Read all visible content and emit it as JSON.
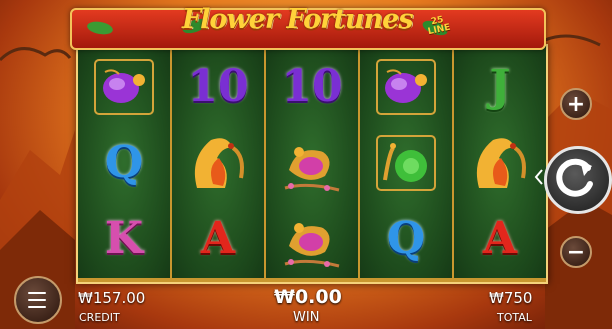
{
  "game": {
    "title": "Flower Fortunes",
    "lines_number": "25",
    "lines_label": "LINE"
  },
  "reels": [
    [
      {
        "kind": "bug-purple"
      },
      {
        "kind": "letter",
        "text": "Q",
        "color": "blue"
      },
      {
        "kind": "letter",
        "text": "K",
        "color": "pink"
      }
    ],
    [
      {
        "kind": "letter",
        "text": "10",
        "color": "purple"
      },
      {
        "kind": "phoenix"
      },
      {
        "kind": "letter",
        "text": "A",
        "color": "red"
      }
    ],
    [
      {
        "kind": "letter",
        "text": "10",
        "color": "purple"
      },
      {
        "kind": "bird-pink"
      },
      {
        "kind": "bird-pink"
      }
    ],
    [
      {
        "kind": "bug-purple"
      },
      {
        "kind": "snail-green"
      },
      {
        "kind": "letter",
        "text": "Q",
        "color": "blue"
      }
    ],
    [
      {
        "kind": "letter",
        "text": "J",
        "color": "green"
      },
      {
        "kind": "phoenix"
      },
      {
        "kind": "letter",
        "text": "A",
        "color": "red"
      }
    ]
  ],
  "controls": {
    "plus_symbol": "+",
    "minus_symbol": "−",
    "spin_icon": "spin-refresh-icon",
    "menu_icon": "hamburger-menu-icon"
  },
  "stats": {
    "credit_value": "₩157.00",
    "credit_label": "CREDIT",
    "win_value": "₩0.00",
    "win_label": "WIN",
    "total_value": "₩750",
    "total_label": "TOTAL"
  }
}
